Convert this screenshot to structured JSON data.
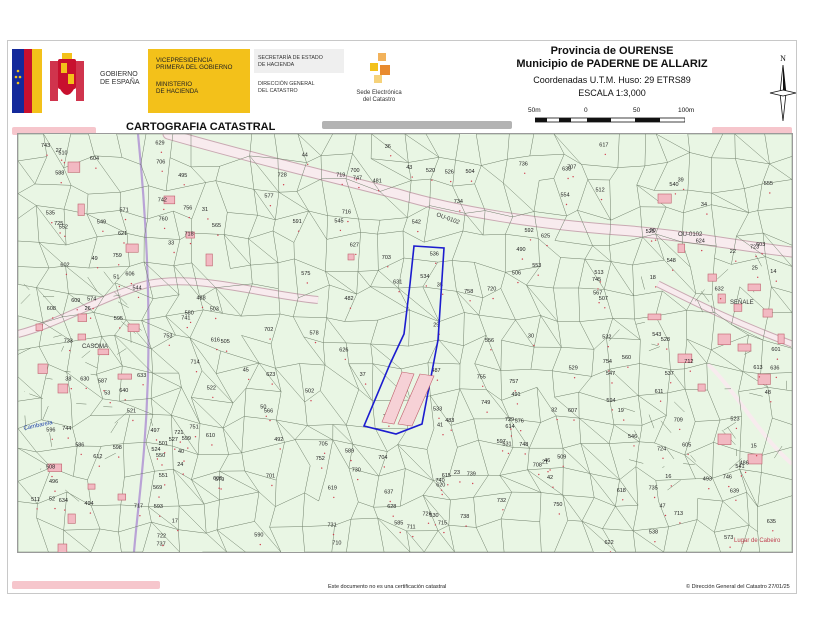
{
  "header": {
    "gov_lines": [
      "GOBIERNO",
      "DE ESPAÑA"
    ],
    "vice_lines": [
      "VICEPRESIDENCIA",
      "PRIMERA DEL GOBIERNO"
    ],
    "ministry_lines": [
      "MINISTERIO",
      "DE HACIENDA"
    ],
    "secretaria_lines": [
      "SECRETARÍA DE ESTADO",
      "DE HACIENDA"
    ],
    "direccion_lines": [
      "DIRECCIÓN GENERAL",
      "DEL CATASTRO"
    ],
    "sede_lines": [
      "Sede Electrónica",
      "del Catastro"
    ],
    "province": "Provincia de OURENSE",
    "municipality": "Municipio de PADERNE DE ALLARIZ",
    "coords": "Coordenadas U.T.M. Huso: 29 ETRS89",
    "scale": "ESCALA 1:3,000",
    "scale_ticks": [
      "50m",
      "0",
      "50",
      "100m"
    ],
    "north": "N",
    "cart_title": "CARTOGRAFIA CATASTRAL"
  },
  "map": {
    "road_labels": [
      "OU-0102",
      "OU-0102"
    ],
    "place_labels": [
      "CASOMA",
      "Cambarela",
      "SEÑALE",
      "Lugar de Cabeiro"
    ],
    "parcel_labels": [
      "29",
      "27",
      "26",
      "25",
      "24",
      "23",
      "22",
      "21",
      "20",
      "19",
      "18",
      "17",
      "16",
      "15",
      "14",
      "481",
      "482",
      "483",
      "486",
      "487",
      "488",
      "490",
      "491",
      "492",
      "493",
      "494",
      "495",
      "496",
      "497",
      "501",
      "502",
      "503",
      "504",
      "505",
      "506",
      "507",
      "508",
      "509",
      "510",
      "511",
      "512",
      "513",
      "520",
      "521",
      "522",
      "523",
      "524",
      "525",
      "526",
      "527",
      "528",
      "529",
      "530",
      "531",
      "532",
      "533",
      "534",
      "535",
      "536",
      "537",
      "538",
      "540",
      "541",
      "542",
      "543",
      "544",
      "545",
      "546",
      "547",
      "548",
      "549",
      "550",
      "551",
      "552",
      "553",
      "554",
      "555",
      "556",
      "560",
      "565",
      "566",
      "567",
      "569",
      "571",
      "573",
      "574",
      "575",
      "576",
      "577",
      "578",
      "579",
      "580",
      "585",
      "586",
      "587",
      "588",
      "589",
      "590",
      "591",
      "592",
      "593",
      "594",
      "595",
      "596",
      "597",
      "598",
      "599",
      "600",
      "601",
      "602",
      "603",
      "604",
      "605",
      "606",
      "607",
      "608",
      "609",
      "610",
      "611",
      "612",
      "613",
      "614",
      "615",
      "616",
      "617",
      "618",
      "619",
      "620",
      "621",
      "622",
      "623",
      "624",
      "625",
      "626",
      "627",
      "628",
      "629",
      "630",
      "631",
      "632",
      "633",
      "634",
      "635",
      "636",
      "637",
      "638",
      "639",
      "640",
      "700",
      "701",
      "702",
      "703",
      "704",
      "705",
      "706",
      "707",
      "708",
      "709",
      "710",
      "711",
      "712",
      "713",
      "714",
      "715",
      "716",
      "717",
      "718",
      "719",
      "720",
      "721",
      "722",
      "723",
      "724",
      "725",
      "726",
      "727",
      "728",
      "729",
      "730",
      "731",
      "732",
      "733",
      "734",
      "735",
      "736",
      "737",
      "738",
      "739",
      "740",
      "741",
      "742",
      "743",
      "744",
      "745",
      "746",
      "747",
      "748",
      "749",
      "750",
      "751",
      "752",
      "753",
      "754",
      "755",
      "756",
      "757",
      "758",
      "759",
      "760",
      "30",
      "31",
      "32",
      "33",
      "34",
      "35",
      "36",
      "37",
      "38",
      "39",
      "40",
      "41",
      "42",
      "43",
      "44",
      "45",
      "46",
      "47",
      "48",
      "49",
      "50",
      "51",
      "52",
      "53"
    ]
  },
  "footer": {
    "note": "Este documento no es una certificación catastral",
    "copyright": "© Dirección General del Catastro 27/01/25"
  },
  "colors": {
    "map_bg": "#e9f6e4",
    "parcel_line": "#6f7f6a",
    "road_fill": "#f8ebee",
    "building": "#f2b9c2",
    "highlight": "#1c1ccf",
    "flag_red": "#c8102e",
    "flag_yellow": "#f3c11a",
    "eu_blue": "#14299a"
  }
}
